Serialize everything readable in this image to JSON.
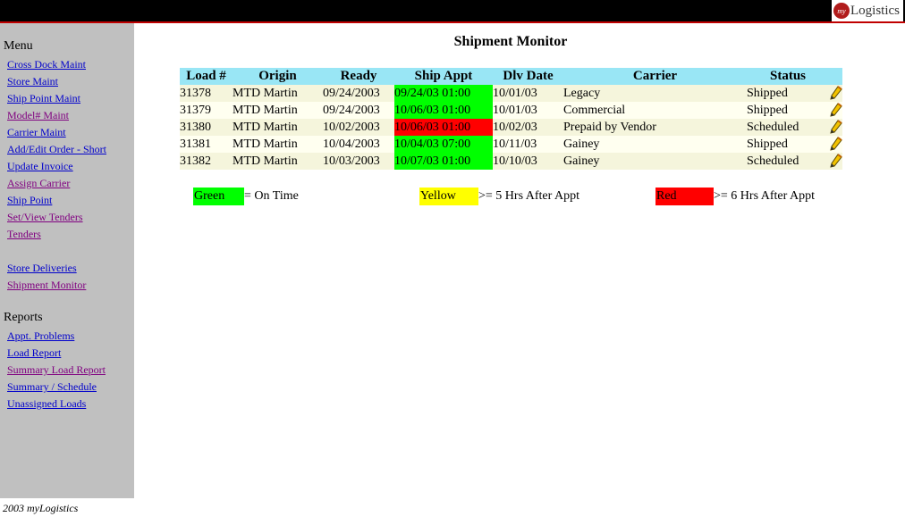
{
  "brand": {
    "logo_badge": "my",
    "logo_text": "Logistics"
  },
  "sidebar": {
    "menu_heading": "Menu",
    "menu_items": [
      {
        "label": "Cross Dock Maint",
        "visited": false
      },
      {
        "label": "Store Maint",
        "visited": false
      },
      {
        "label": "Ship Point Maint",
        "visited": false
      },
      {
        "label": "Model# Maint",
        "visited": true
      },
      {
        "label": "Carrier Maint",
        "visited": false
      },
      {
        "label": "Add/Edit Order - Short",
        "visited": false
      },
      {
        "label": "Update Invoice",
        "visited": false
      },
      {
        "label": "Assign Carrier",
        "visited": true
      },
      {
        "label": "Ship Point",
        "visited": false
      },
      {
        "label": "Set/View Tenders",
        "visited": true
      },
      {
        "label": "Tenders",
        "visited": true
      },
      {
        "label": "Store Deliveries",
        "visited": false
      },
      {
        "label": "Shipment Monitor",
        "visited": true
      }
    ],
    "reports_heading": "Reports",
    "report_items": [
      {
        "label": "Appt. Problems",
        "visited": false
      },
      {
        "label": "Load Report",
        "visited": false
      },
      {
        "label": "Summary Load Report",
        "visited": true
      },
      {
        "label": "Summary / Schedule",
        "visited": false
      },
      {
        "label": "Unassigned Loads",
        "visited": false
      }
    ]
  },
  "footer": "2003 myLogistics",
  "main": {
    "title": "Shipment Monitor",
    "columns": [
      "Load #",
      "Origin",
      "Ready",
      "Ship Appt",
      "Dlv Date",
      "Carrier",
      "Status",
      ""
    ],
    "rows": [
      {
        "load": "31378",
        "origin": "MTD Martin",
        "ready": "09/24/2003",
        "ship_appt": "09/24/03 01:00",
        "appt_status": "green",
        "dlv_date": "10/01/03",
        "carrier": "Legacy",
        "status": "Shipped"
      },
      {
        "load": "31379",
        "origin": "MTD Martin",
        "ready": "09/24/2003",
        "ship_appt": "10/06/03 01:00",
        "appt_status": "green",
        "dlv_date": "10/01/03",
        "carrier": "Commercial",
        "status": "Shipped"
      },
      {
        "load": "31380",
        "origin": "MTD Martin",
        "ready": "10/02/2003",
        "ship_appt": "10/06/03 01:00",
        "appt_status": "red",
        "dlv_date": "10/02/03",
        "carrier": "Prepaid by Vendor",
        "status": "Scheduled"
      },
      {
        "load": "31381",
        "origin": "MTD Martin",
        "ready": "10/04/2003",
        "ship_appt": "10/04/03 07:00",
        "appt_status": "green",
        "dlv_date": "10/11/03",
        "carrier": "Gainey",
        "status": "Shipped"
      },
      {
        "load": "31382",
        "origin": "MTD Martin",
        "ready": "10/03/2003",
        "ship_appt": "10/07/03 01:00",
        "appt_status": "green",
        "dlv_date": "10/10/03",
        "carrier": "Gainey",
        "status": "Scheduled"
      }
    ],
    "legend": {
      "green_label": "Green",
      "green_text": "= On Time",
      "green_color": "#00ff00",
      "yellow_label": "Yellow",
      "yellow_text": ">= 5 Hrs After Appt",
      "yellow_color": "#ffff00",
      "red_label": "Red",
      "red_text": ">= 6 Hrs After Appt",
      "red_color": "#ff0000"
    }
  },
  "colors": {
    "header_bg": "#99e6f5",
    "sidebar_bg": "#c0c0c0",
    "link": "#0000cc",
    "visited_link": "#800080",
    "topbar_accent": "#c00000"
  }
}
